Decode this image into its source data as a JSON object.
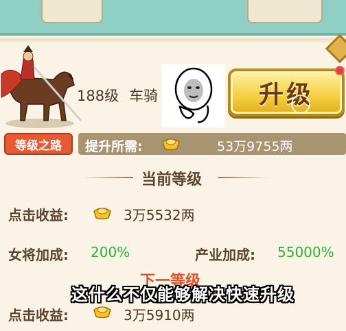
{
  "general": {
    "level": "188级",
    "title": "车骑"
  },
  "upgrade_button": {
    "label": "升级"
  },
  "road_tag": "等级之路",
  "upgrade_cost": {
    "label": "提升所需:",
    "value": "53万9755两"
  },
  "current_level": {
    "heading": "当前等级",
    "click_income_label": "点击收益:",
    "click_income_value": "3万5532两",
    "female_bonus_label": "女将加成:",
    "female_bonus_value": "200%",
    "industry_bonus_label": "产业加成:",
    "industry_bonus_value": "55000%"
  },
  "next_level": {
    "heading": "下一等级",
    "click_income_label": "点击收益:",
    "click_income_value": "3万5910两"
  },
  "subtitle": "这什么不仅能够解决快速升级",
  "colors": {
    "accent_green": "#2eae3c",
    "button_gold": "#f3cf3f",
    "tag_red": "#e85a33",
    "bar_brown": "#a89470"
  },
  "icons": [
    "gold-ingot-icon",
    "general-on-horse",
    "meme-face"
  ]
}
